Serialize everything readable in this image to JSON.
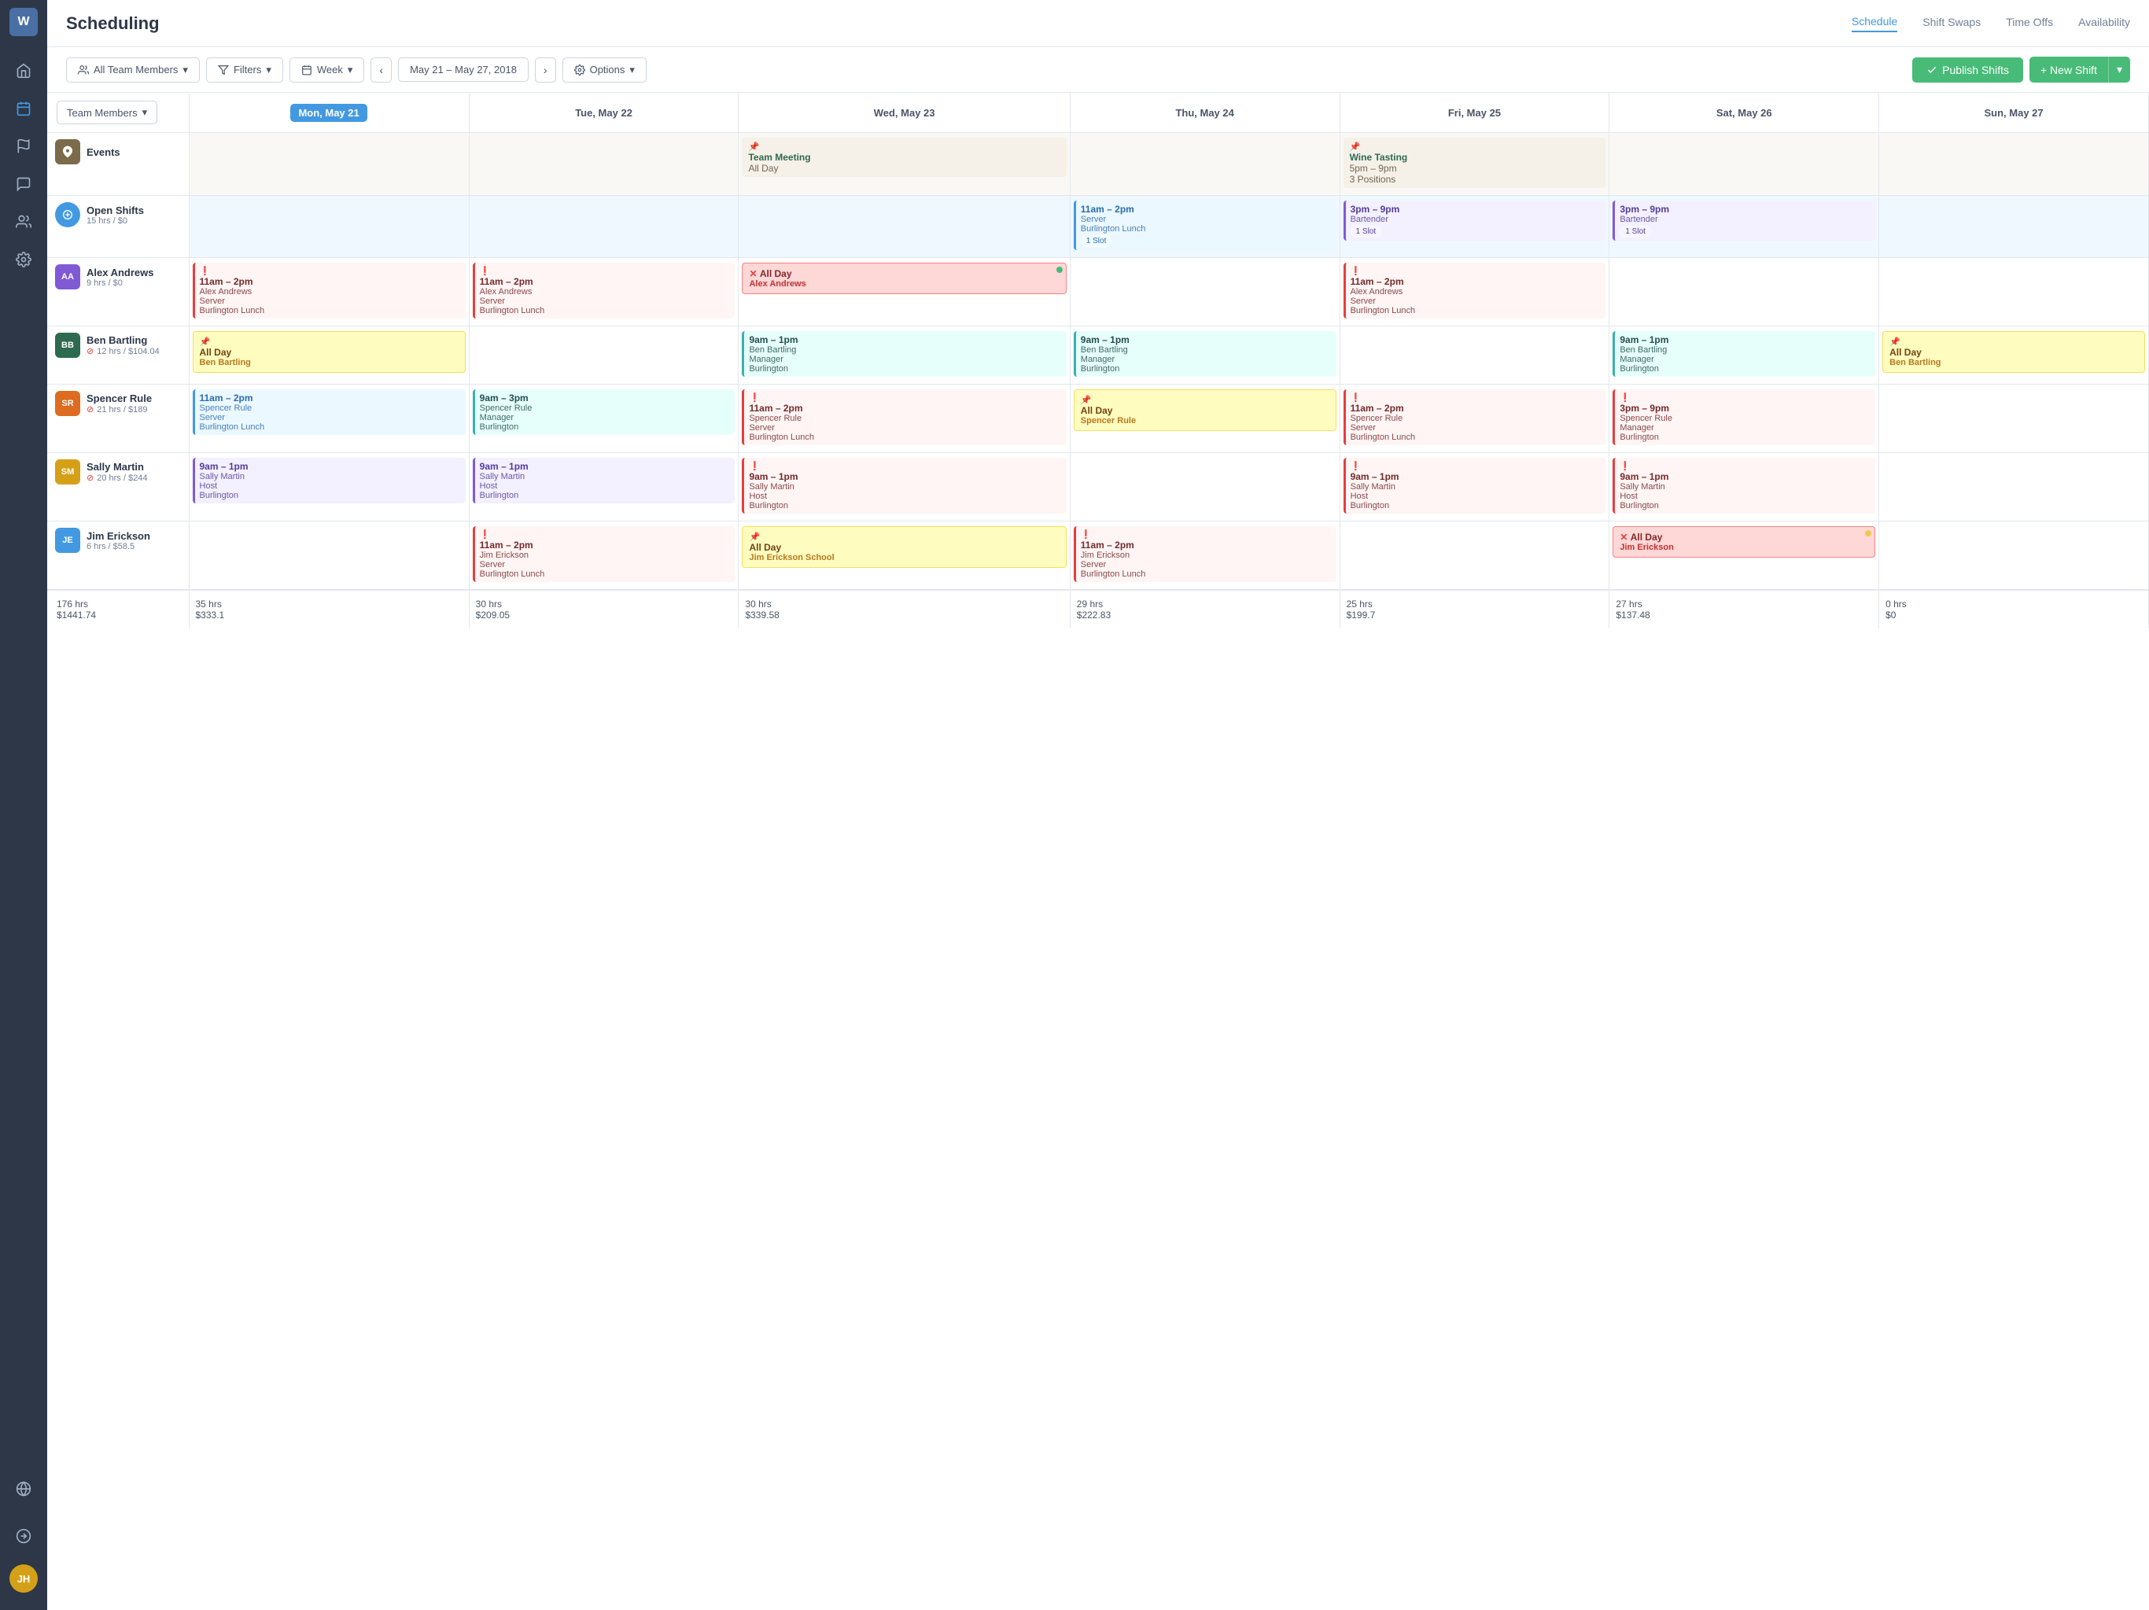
{
  "app": {
    "logo": "W",
    "title": "Scheduling"
  },
  "nav": {
    "tabs": [
      {
        "id": "schedule",
        "label": "Schedule",
        "active": true
      },
      {
        "id": "shift-swaps",
        "label": "Shift Swaps",
        "active": false
      },
      {
        "id": "time-offs",
        "label": "Time Offs",
        "active": false
      },
      {
        "id": "availability",
        "label": "Availability",
        "active": false
      }
    ]
  },
  "toolbar": {
    "team_members_label": "All Team Members",
    "filters_label": "Filters",
    "week_label": "Week",
    "date_range": "May 21 – May 27, 2018",
    "options_label": "Options",
    "publish_label": "Publish Shifts",
    "new_shift_label": "+ New Shift"
  },
  "calendar": {
    "row_header": "Team Members",
    "days": [
      {
        "id": "mon",
        "label": "Mon, May 21",
        "today": true
      },
      {
        "id": "tue",
        "label": "Tue, May 22",
        "today": false
      },
      {
        "id": "wed",
        "label": "Wed, May 23",
        "today": false
      },
      {
        "id": "thu",
        "label": "Thu, May 24",
        "today": false
      },
      {
        "id": "fri",
        "label": "Fri, May 25",
        "today": false
      },
      {
        "id": "sat",
        "label": "Sat, May 26",
        "today": false
      },
      {
        "id": "sun",
        "label": "Sun, May 27",
        "today": false
      }
    ],
    "rows": [
      {
        "id": "events",
        "avatar_initials": "📌",
        "avatar_type": "events",
        "name": "Events",
        "hrs": "",
        "is_events": true,
        "cells": [
          {
            "day": "mon",
            "events": []
          },
          {
            "day": "tue",
            "events": []
          },
          {
            "day": "wed",
            "events": [
              {
                "type": "event-tan",
                "title": "Team Meeting",
                "sub": "All Day",
                "pin": true
              }
            ]
          },
          {
            "day": "thu",
            "events": []
          },
          {
            "day": "fri",
            "events": [
              {
                "type": "event-tan",
                "title": "Wine Tasting",
                "sub": "5pm – 9pm",
                "sub2": "3 Positions",
                "pin": true
              }
            ]
          },
          {
            "day": "sat",
            "events": []
          },
          {
            "day": "sun",
            "events": []
          }
        ]
      },
      {
        "id": "open-shifts",
        "avatar_initials": "⊙",
        "avatar_type": "open",
        "name": "Open Shifts",
        "hrs": "15 hrs / $0",
        "is_open": true,
        "cells": [
          {
            "day": "mon",
            "events": []
          },
          {
            "day": "tue",
            "events": []
          },
          {
            "day": "wed",
            "events": []
          },
          {
            "day": "thu",
            "events": [
              {
                "type": "shift-blue",
                "title": "11am – 2pm",
                "sub": "Server",
                "sub2": "Burlington Lunch",
                "badge": "1 Slot"
              }
            ]
          },
          {
            "day": "fri",
            "events": [
              {
                "type": "shift-purple",
                "title": "3pm – 9pm",
                "sub": "Bartender",
                "badge": "1 Slot"
              }
            ]
          },
          {
            "day": "sat",
            "events": [
              {
                "type": "shift-purple",
                "title": "3pm – 9pm",
                "sub": "Bartender",
                "badge": "1 Slot"
              }
            ]
          },
          {
            "day": "sun",
            "events": []
          }
        ]
      },
      {
        "id": "alex-andrews",
        "avatar_initials": "AA",
        "avatar_color": "#805ad5",
        "name": "Alex Andrews",
        "hrs": "9 hrs / $0",
        "overtime": false,
        "cells": [
          {
            "day": "mon",
            "events": [
              {
                "type": "shift-red-warn",
                "title": "11am – 2pm",
                "sub": "Alex Andrews",
                "sub2": "Server",
                "sub3": "Burlington Lunch",
                "warn": true
              }
            ]
          },
          {
            "day": "tue",
            "events": [
              {
                "type": "shift-red-warn",
                "title": "11am – 2pm",
                "sub": "Alex Andrews",
                "sub2": "Server",
                "sub3": "Burlington Lunch",
                "warn": true
              }
            ]
          },
          {
            "day": "wed",
            "events": [
              {
                "type": "shift-allday-pink",
                "title": "All Day",
                "sub": "Alex Andrews",
                "x_icon": true,
                "green_dot": true
              }
            ]
          },
          {
            "day": "thu",
            "events": []
          },
          {
            "day": "fri",
            "events": [
              {
                "type": "shift-red-warn",
                "title": "11am – 2pm",
                "sub": "Alex Andrews",
                "sub2": "Server",
                "sub3": "Burlington Lunch",
                "warn": true
              }
            ]
          },
          {
            "day": "sat",
            "events": []
          },
          {
            "day": "sun",
            "events": []
          }
        ]
      },
      {
        "id": "ben-bartling",
        "avatar_initials": "BB",
        "avatar_color": "#2d6a4f",
        "name": "Ben Bartling",
        "hrs": "12 hrs / $104.04",
        "overtime": true,
        "cells": [
          {
            "day": "mon",
            "events": [
              {
                "type": "shift-allday-yellow",
                "title": "All Day",
                "sub": "Ben Bartling",
                "pin": true
              }
            ]
          },
          {
            "day": "tue",
            "events": []
          },
          {
            "day": "wed",
            "events": [
              {
                "type": "shift-teal",
                "title": "9am – 1pm",
                "sub": "Ben Bartling",
                "sub2": "Manager",
                "sub3": "Burlington"
              }
            ]
          },
          {
            "day": "thu",
            "events": [
              {
                "type": "shift-teal",
                "title": "9am – 1pm",
                "sub": "Ben Bartling",
                "sub2": "Manager",
                "sub3": "Burlington"
              }
            ]
          },
          {
            "day": "fri",
            "events": []
          },
          {
            "day": "sat",
            "events": [
              {
                "type": "shift-teal",
                "title": "9am – 1pm",
                "sub": "Ben Bartling",
                "sub2": "Manager",
                "sub3": "Burlington"
              }
            ]
          },
          {
            "day": "sun",
            "events": [
              {
                "type": "shift-allday-yellow",
                "title": "All Day",
                "sub": "Ben Bartling",
                "pin": true
              }
            ]
          }
        ]
      },
      {
        "id": "spencer-rule",
        "avatar_initials": "SR",
        "avatar_color": "#dd6b20",
        "name": "Spencer Rule",
        "hrs": "21 hrs / $189",
        "overtime": true,
        "cells": [
          {
            "day": "mon",
            "events": [
              {
                "type": "shift-blue",
                "title": "11am – 2pm",
                "sub": "Spencer Rule",
                "sub2": "Server",
                "sub3": "Burlington Lunch"
              }
            ]
          },
          {
            "day": "tue",
            "events": [
              {
                "type": "shift-teal",
                "title": "9am – 3pm",
                "sub": "Spencer Rule",
                "sub2": "Manager",
                "sub3": "Burlington"
              }
            ]
          },
          {
            "day": "wed",
            "events": [
              {
                "type": "shift-red-warn",
                "title": "11am – 2pm",
                "sub": "Spencer Rule",
                "sub2": "Server",
                "sub3": "Burlington Lunch",
                "warn": true
              }
            ]
          },
          {
            "day": "thu",
            "events": [
              {
                "type": "shift-allday-yellow",
                "title": "All Day",
                "sub": "Spencer Rule",
                "pin": true
              }
            ]
          },
          {
            "day": "fri",
            "events": [
              {
                "type": "shift-red-warn",
                "title": "11am – 2pm",
                "sub": "Spencer Rule",
                "sub2": "Server",
                "sub3": "Burlington Lunch",
                "warn": true
              }
            ]
          },
          {
            "day": "sat",
            "events": [
              {
                "type": "shift-red-warn",
                "title": "3pm – 9pm",
                "sub": "Spencer Rule",
                "sub2": "Manager",
                "sub3": "Burlington",
                "warn": true
              }
            ]
          },
          {
            "day": "sun",
            "events": []
          }
        ]
      },
      {
        "id": "sally-martin",
        "avatar_initials": "SM",
        "avatar_color": "#d4a017",
        "name": "Sally Martin",
        "hrs": "20 hrs / $244",
        "overtime": true,
        "cells": [
          {
            "day": "mon",
            "events": [
              {
                "type": "shift-purple",
                "title": "9am – 1pm",
                "sub": "Sally Martin",
                "sub2": "Host",
                "sub3": "Burlington"
              }
            ]
          },
          {
            "day": "tue",
            "events": [
              {
                "type": "shift-purple",
                "title": "9am – 1pm",
                "sub": "Sally Martin",
                "sub2": "Host",
                "sub3": "Burlington"
              }
            ]
          },
          {
            "day": "wed",
            "events": [
              {
                "type": "shift-red-warn",
                "title": "9am – 1pm",
                "sub": "Sally Martin",
                "sub2": "Host",
                "sub3": "Burlington",
                "warn": true
              }
            ]
          },
          {
            "day": "thu",
            "events": []
          },
          {
            "day": "fri",
            "events": [
              {
                "type": "shift-red-warn",
                "title": "9am – 1pm",
                "sub": "Sally Martin",
                "sub2": "Host",
                "sub3": "Burlington",
                "warn": true
              }
            ]
          },
          {
            "day": "sat",
            "events": [
              {
                "type": "shift-red-warn",
                "title": "9am – 1pm",
                "sub": "Sally Martin",
                "sub2": "Host",
                "sub3": "Burlington",
                "warn": true
              }
            ]
          },
          {
            "day": "sun",
            "events": []
          }
        ]
      },
      {
        "id": "jim-erickson",
        "avatar_initials": "JE",
        "avatar_color": "#4299e1",
        "name": "Jim Erickson",
        "hrs": "6 hrs / $58.5",
        "overtime": false,
        "cells": [
          {
            "day": "mon",
            "events": []
          },
          {
            "day": "tue",
            "events": [
              {
                "type": "shift-red-warn",
                "title": "11am – 2pm",
                "sub": "Jim Erickson",
                "sub2": "Server",
                "sub3": "Burlington Lunch",
                "warn": true
              }
            ]
          },
          {
            "day": "wed",
            "events": [
              {
                "type": "shift-allday-yellow-school",
                "title": "All Day",
                "sub": "Jim Erickson School",
                "pin": true
              }
            ]
          },
          {
            "day": "thu",
            "events": [
              {
                "type": "shift-red-warn",
                "title": "11am – 2pm",
                "sub": "Jim Erickson",
                "sub2": "Server",
                "sub3": "Burlington Lunch",
                "warn": true
              }
            ]
          },
          {
            "day": "fri",
            "events": []
          },
          {
            "day": "sat",
            "events": [
              {
                "type": "shift-allday-pink",
                "title": "All Day",
                "sub": "Jim Erickson",
                "x_icon": true,
                "yellow_dot": true
              }
            ]
          },
          {
            "day": "sun",
            "events": []
          }
        ]
      }
    ],
    "footer": {
      "total_label": "176 hrs\n$1441.74",
      "mon": "35 hrs\n$333.1",
      "tue": "30 hrs\n$209.05",
      "wed": "30 hrs\n$339.58",
      "thu": "29 hrs\n$222.83",
      "fri": "25 hrs\n$199.7",
      "sat": "27 hrs\n$137.48",
      "sun": "0 hrs\n$0"
    }
  }
}
